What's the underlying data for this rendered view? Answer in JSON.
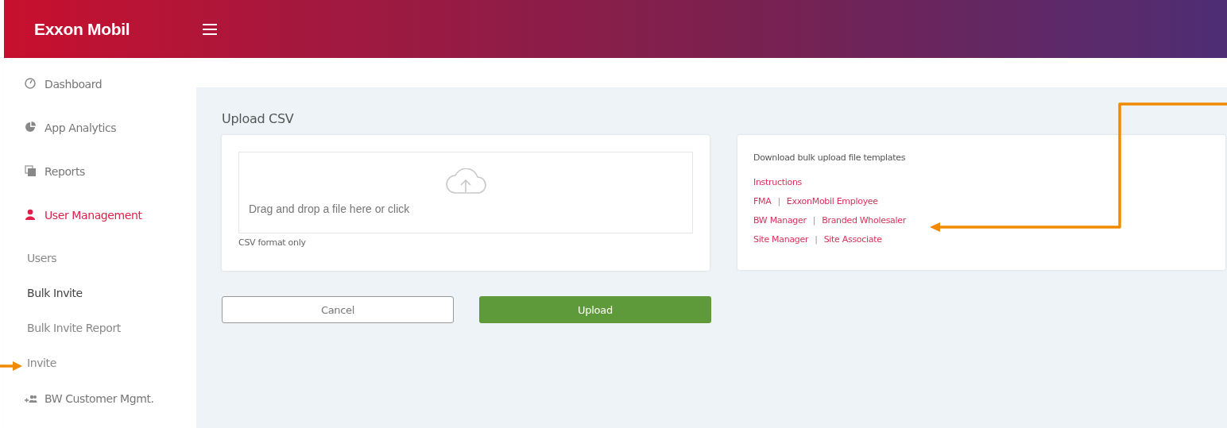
{
  "header": {
    "logo": "Exxon Mobil"
  },
  "sidebar": {
    "items": [
      {
        "kind": "dashboard",
        "label": "Dashboard",
        "selected": false
      },
      {
        "kind": "analytics",
        "label": "App Analytics",
        "selected": false
      },
      {
        "kind": "reports",
        "label": "Reports",
        "selected": false
      },
      {
        "kind": "user",
        "label": "User Management",
        "selected": true,
        "children": [
          {
            "label": "Users",
            "selected": false
          },
          {
            "label": "Bulk Invite",
            "selected": true
          },
          {
            "label": "Bulk Invite Report",
            "selected": false
          },
          {
            "label": "Invite",
            "selected": false
          }
        ]
      },
      {
        "kind": "group",
        "label": "BW Customer Mgmt.",
        "selected": false
      }
    ]
  },
  "upload": {
    "title": "Upload CSV",
    "dropzone": "Drag and drop a file here or click",
    "hint": "CSV format only",
    "buttons": [
      {
        "kind": "secondary",
        "label": "Cancel"
      },
      {
        "kind": "primary",
        "label": "Upload"
      }
    ]
  },
  "templates": {
    "title": "Download bulk upload file templates",
    "rows": [
      {
        "links": [
          "Instructions"
        ]
      },
      {
        "links": [
          "FMA",
          "ExxonMobil Employee"
        ],
        "separator": "|"
      },
      {
        "links": [
          "BW Manager",
          "Branded Wholesaler"
        ],
        "separator": "|"
      },
      {
        "links": [
          "Site Manager",
          "Site Associate"
        ],
        "separator": "|"
      }
    ]
  }
}
